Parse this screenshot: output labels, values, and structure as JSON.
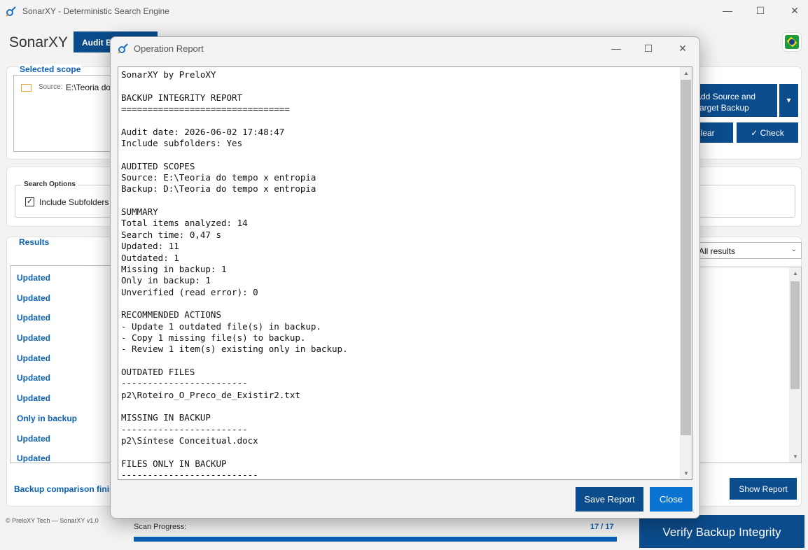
{
  "window": {
    "title": "SonarXY - Deterministic Search Engine"
  },
  "header": {
    "brand": "SonarXY",
    "active_tab": "Audit Backup",
    "flag_icon": "brazil-flag-icon"
  },
  "scope": {
    "label": "Selected scope",
    "source_label": "Source:",
    "source_path": "E:\\Teoria do tempo x entropia"
  },
  "actions": {
    "add_source_target": "Add Source and Target Backup",
    "add_dropdown": "▾",
    "clear": "Clear",
    "check": "✓ Check"
  },
  "search_options": {
    "legend": "Search Options",
    "include_subfolders": "Include Subfolders",
    "include_subfolders_checked": true
  },
  "results": {
    "label": "Results",
    "filter_value": "All results",
    "items": [
      "Updated",
      "Updated",
      "Updated",
      "Updated",
      "Updated",
      "Updated",
      "Updated",
      "Only in backup",
      "Updated",
      "Updated"
    ],
    "status": "Backup comparison finished",
    "show_report": "Show Report"
  },
  "footer": {
    "copyright": "© PreloXY Tech — SonarXY v1.0",
    "progress_label": "Scan Progress:",
    "progress_count": "17 / 17",
    "progress_fraction": 1.0,
    "verify_button": "Verify Backup Integrity"
  },
  "dialog": {
    "title": "Operation Report",
    "save_button": "Save Report",
    "close_button": "Close",
    "report_lines": [
      "SonarXY by PreloXY",
      "",
      "BACKUP INTEGRITY REPORT",
      "================================",
      "",
      "Audit date: 2026-06-02 17:48:47",
      "Include subfolders: Yes",
      "",
      "AUDITED SCOPES",
      "Source: E:\\Teoria do tempo x entropia",
      "Backup: D:\\Teoria do tempo x entropia",
      "",
      "SUMMARY",
      "Total items analyzed: 14",
      "Search time: 0,47 s",
      "Updated: 11",
      "Outdated: 1",
      "Missing in backup: 1",
      "Only in backup: 1",
      "Unverified (read error): 0",
      "",
      "RECOMMENDED ACTIONS",
      "- Update 1 outdated file(s) in backup.",
      "- Copy 1 missing file(s) to backup.",
      "- Review 1 item(s) existing only in backup.",
      "",
      "OUTDATED FILES",
      "------------------------",
      "p2\\Roteiro_O_Preco_de_Existir2.txt",
      "",
      "MISSING IN BACKUP",
      "------------------------",
      "p2\\Síntese Conceitual.docx",
      "",
      "FILES ONLY IN BACKUP",
      "--------------------------"
    ]
  }
}
